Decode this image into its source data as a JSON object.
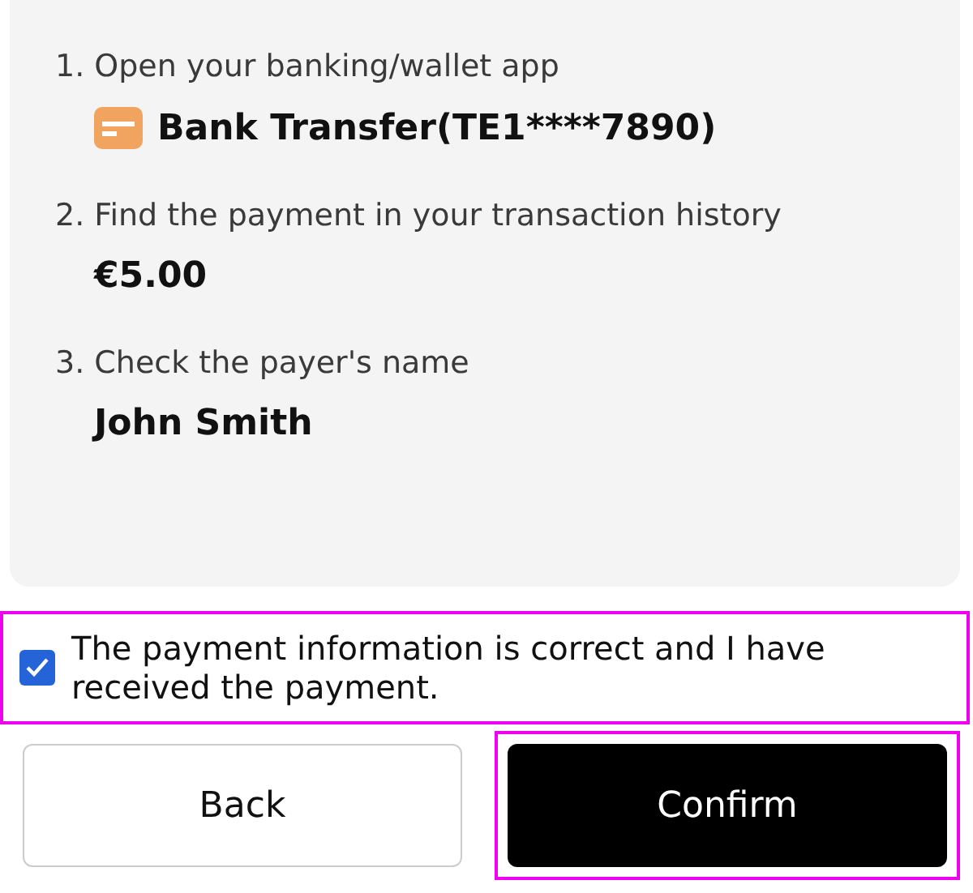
{
  "steps": [
    {
      "label": "1. Open your banking/wallet app",
      "kind": "method",
      "value": "Bank Transfer(TE1****7890)"
    },
    {
      "label": "2. Find the payment in your transaction history",
      "kind": "plain",
      "value": "€5.00"
    },
    {
      "label": "3. Check the payer's name",
      "kind": "plain",
      "value": "John Smith"
    }
  ],
  "confirmation": {
    "text": "The payment information is correct and I have received the payment.",
    "checked": true,
    "highlighted": true
  },
  "buttons": [
    {
      "label": "Back",
      "kind": "secondary",
      "highlighted": false
    },
    {
      "label": "Confirm",
      "kind": "primary",
      "highlighted": true
    }
  ]
}
